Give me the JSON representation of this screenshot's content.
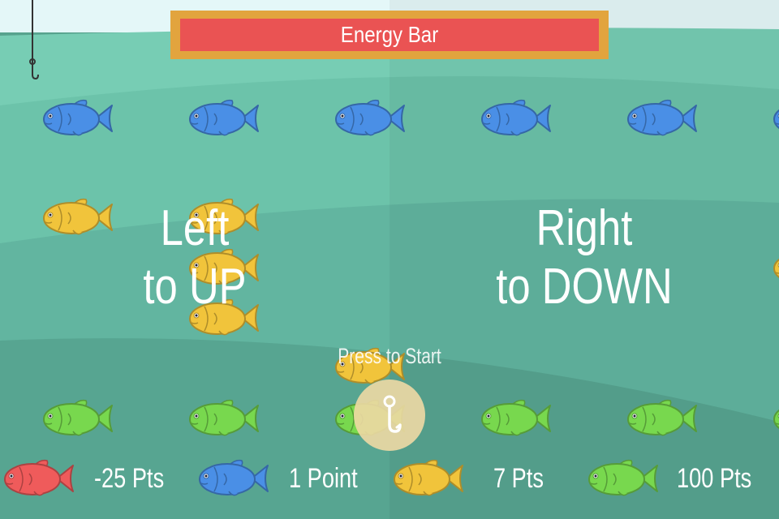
{
  "energy_bar": {
    "label": "Energy Bar",
    "frame_color": "#e2a43e",
    "fill_color": "#ea5353"
  },
  "instructions": {
    "left_line1": "Left",
    "left_line2": "to UP",
    "right_line1": "Right",
    "right_line2": "to DOWN"
  },
  "start": {
    "label": "Press to Start",
    "icon": "hook-icon"
  },
  "fish_colors": {
    "blue": "#4a8fe6",
    "yellow": "#f1c43b",
    "green": "#78d84e",
    "red": "#ef5b5b"
  },
  "legend": [
    {
      "fish": "red",
      "label": "-25 Pts"
    },
    {
      "fish": "blue",
      "label": "1 Point"
    },
    {
      "fish": "yellow",
      "label": "7 Pts"
    },
    {
      "fish": "green",
      "label": "100 Pts"
    }
  ]
}
